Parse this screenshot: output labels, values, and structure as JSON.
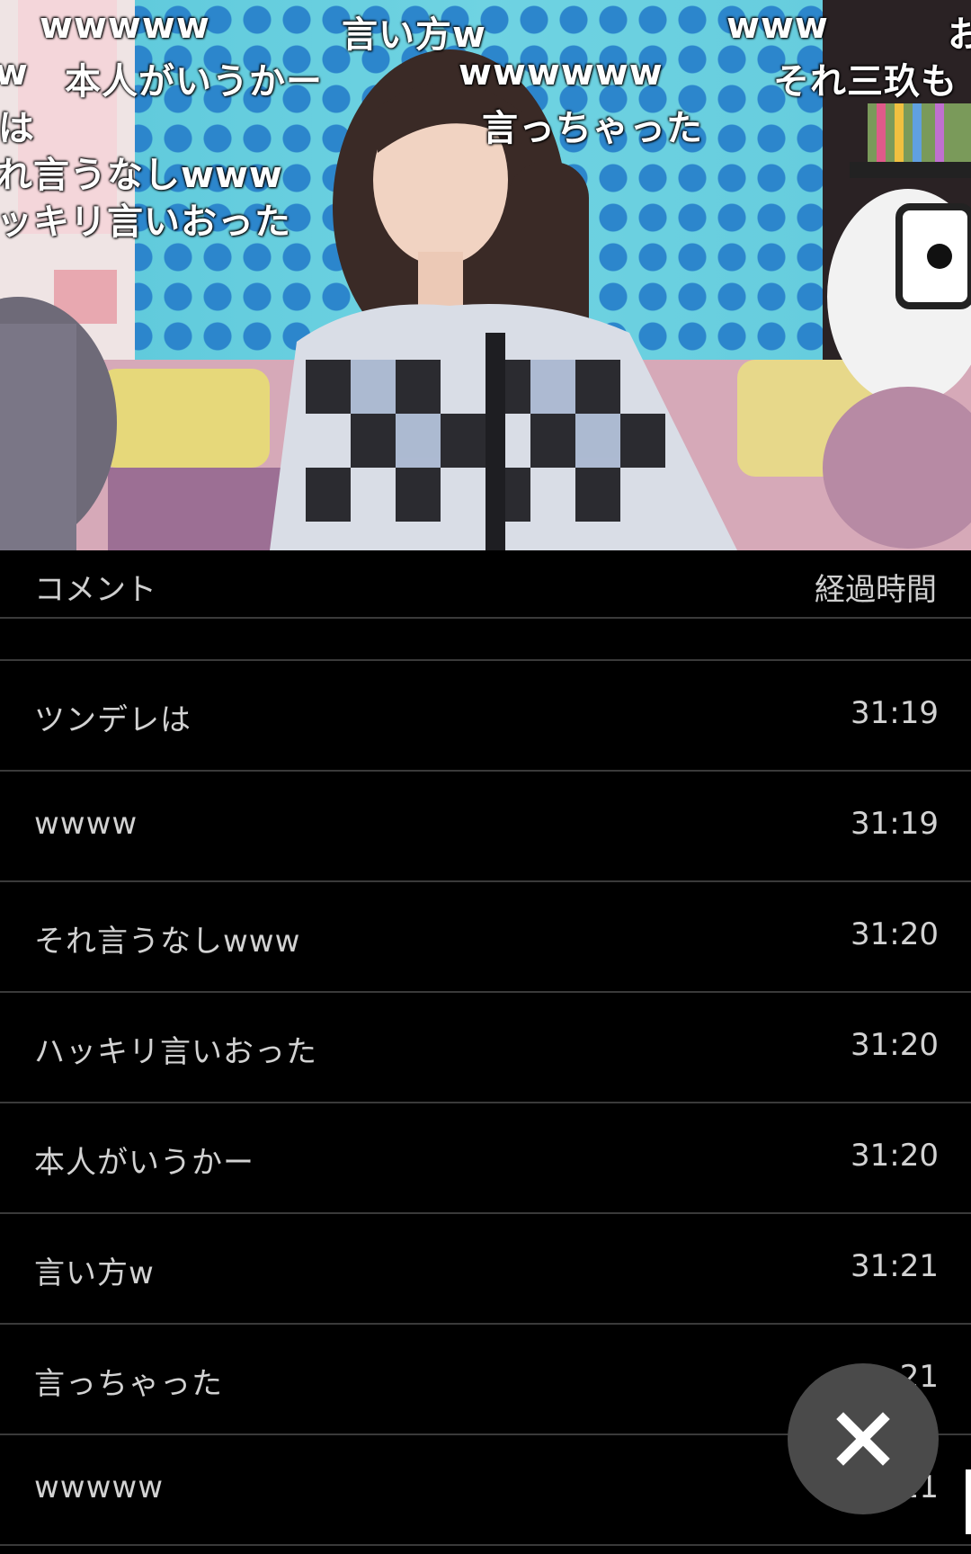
{
  "video": {
    "overlay_comments": [
      "wwwww",
      "言い方w",
      "www",
      "お",
      "w",
      "本人がいうかー",
      "wwwwww",
      "それ三玖も",
      "は",
      "言っちゃった",
      "れ言うなしwww",
      "ッキリ言いおった"
    ]
  },
  "comment_list": {
    "header_comment": "コメント",
    "header_elapsed": "経過時間",
    "rows": [
      {
        "text": "ツンデレは",
        "time": "31:19"
      },
      {
        "text": "wwww",
        "time": "31:19"
      },
      {
        "text": "それ言うなしwww",
        "time": "31:20"
      },
      {
        "text": "ハッキリ言いおった",
        "time": "31:20"
      },
      {
        "text": "本人がいうかー",
        "time": "31:20"
      },
      {
        "text": "言い方w",
        "time": "31:21"
      },
      {
        "text": "言っちゃった",
        "time": "21"
      },
      {
        "text": "wwwww",
        "time": "21"
      }
    ]
  },
  "close_button": {
    "icon": "close-icon"
  },
  "colors": {
    "background": "#000000",
    "divider": "#3a3a3a",
    "fab": "#4a4a4a"
  }
}
